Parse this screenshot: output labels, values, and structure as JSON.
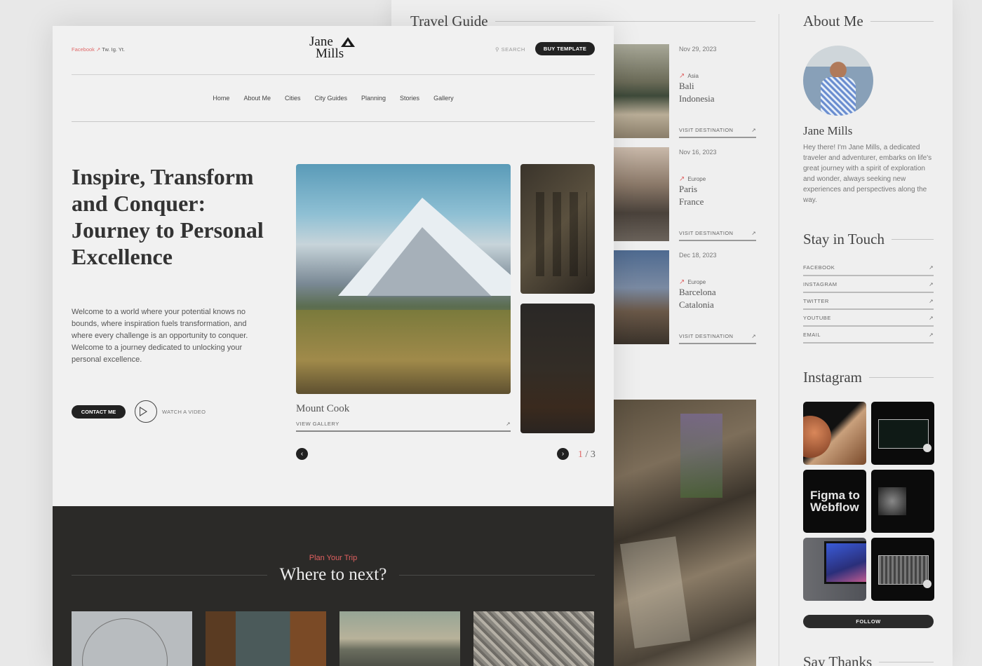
{
  "travel_guide": {
    "title": "Travel Guide",
    "items": [
      {
        "date": "Nov 29, 2023",
        "region": "Asia",
        "city": "Bali",
        "country": "Indonesia",
        "link": "VISIT DESTINATION",
        "arrow": "↗"
      },
      {
        "date": "Nov 16, 2023",
        "region": "Europe",
        "city": "Paris",
        "country": "France",
        "link": "VISIT DESTINATION",
        "arrow": "↗"
      },
      {
        "date": "Dec 18, 2023",
        "region": "Europe",
        "city": "Barcelona",
        "country": "Catalonia",
        "link": "VISIT DESTINATION",
        "arrow": "↗"
      }
    ]
  },
  "sidebar": {
    "about_title": "About Me",
    "name": "Jane Mills",
    "bio": "Hey there! I'm Jane Mills, a dedicated traveler and adventurer, embarks on life's great journey with a spirit of exploration and wonder, always seeking new experiences and perspectives along the way.",
    "stay_title": "Stay in Touch",
    "social_links": [
      {
        "label": "FACEBOOK",
        "arrow": "↗"
      },
      {
        "label": "INSTAGRAM",
        "arrow": "↗"
      },
      {
        "label": "TWITTER",
        "arrow": "↗"
      },
      {
        "label": "YOUTUBE",
        "arrow": "↗"
      },
      {
        "label": "EMAIL",
        "arrow": "↗"
      }
    ],
    "instagram_title": "Instagram",
    "instagram_posts": [
      "Mars space website",
      "OWDA website",
      "Figma to Webflow",
      "Lemna website",
      "Desk setup",
      "OWDA website 2"
    ],
    "figma_text": "Figma to Webflow",
    "follow_label": "FOLLOW",
    "say_thanks_title": "Say Thanks"
  },
  "header": {
    "social_facebook": "Facebook",
    "social_arrow": "↗",
    "social_others": "Tw. Ig. Yt.",
    "logo_line1": "Jane",
    "logo_line2": "Mills",
    "search_icon": "⚲",
    "search_label": "SEARCH",
    "buy_label": "BUY TEMPLATE"
  },
  "nav": {
    "items": [
      "Home",
      "About Me",
      "Cities",
      "City Guides",
      "Planning",
      "Stories",
      "Gallery"
    ]
  },
  "hero": {
    "title": "Inspire, Transform and Conquer: Journey to Personal Excellence",
    "text": "Welcome to a world where your potential knows no bounds, where inspiration fuels transformation, and where every challenge is an opportunity to conquer. Welcome to a journey dedicated to unlocking your personal excellence.",
    "contact_label": "CONTACT ME",
    "watch_label": "WATCH A VIDEO"
  },
  "slider": {
    "caption": "Mount Cook",
    "gallery_label": "VIEW GALLERY",
    "gallery_arrow": "↗",
    "prev": "‹",
    "next": "›",
    "current": "1",
    "separator": "/",
    "total": "3"
  },
  "plan": {
    "eyebrow": "Plan Your Trip",
    "title": "Where to next?",
    "destinations": [
      "London Eye",
      "Palm trees",
      "Mountain lake",
      "Hillside city"
    ]
  }
}
